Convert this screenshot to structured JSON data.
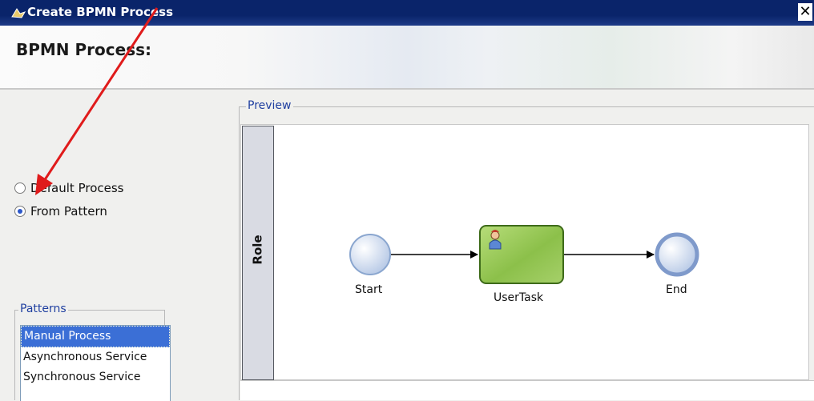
{
  "window": {
    "title": "Create BPMN Process",
    "close_glyph": "✕"
  },
  "header": {
    "page_title": "BPMN Process:"
  },
  "creation_mode": {
    "options": [
      {
        "label": "Default Process",
        "selected": false
      },
      {
        "label": "From Pattern",
        "selected": true
      }
    ]
  },
  "patterns": {
    "legend": "Patterns",
    "items": [
      "Manual Process",
      "Asynchronous Service",
      "Synchronous Service"
    ],
    "selected": "Manual Process"
  },
  "preview": {
    "legend": "Preview",
    "lane": "Role",
    "nodes": {
      "start": "Start",
      "task": "UserTask",
      "end": "End"
    }
  },
  "colors": {
    "titlebar": "#0a246a",
    "annotation_arrow": "#e01b1b",
    "task_fill": "#8cc04a",
    "event_fill": "#d8e3f2",
    "selection": "#3b6fd6"
  },
  "icons": [
    "app-icon",
    "close-icon",
    "user-icon",
    "annotation-arrow"
  ]
}
